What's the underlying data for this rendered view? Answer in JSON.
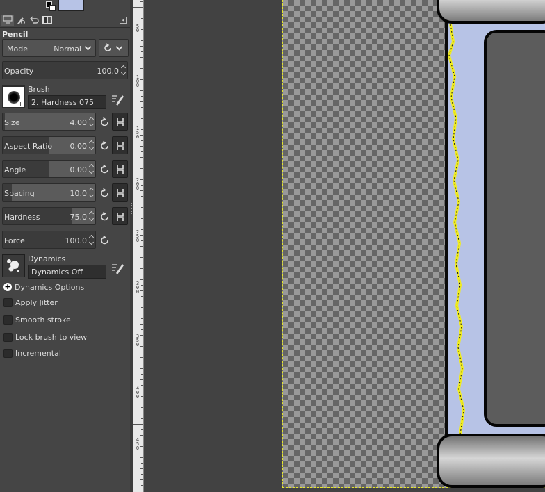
{
  "colors": {
    "foreground_swatch": "#b7c3e6",
    "panel_bg": "#454545",
    "selection_marching_ants": "#e6e62a",
    "drawing_fill": "#b7c3e6"
  },
  "tabs": [
    {
      "icon": "tool-options-icon"
    },
    {
      "icon": "device-status-icon"
    },
    {
      "icon": "undo-history-icon"
    },
    {
      "icon": "images-icon"
    }
  ],
  "tool": {
    "title": "Pencil",
    "mode_label": "Mode",
    "mode_value": "Normal",
    "opacity": {
      "label": "Opacity",
      "value": "100.0",
      "fraction": 1.0
    },
    "brush": {
      "title": "Brush",
      "name": "2. Hardness 075"
    },
    "sliders": [
      {
        "key": "size",
        "label": "Size",
        "value": "4.00",
        "fraction": 0.005
      },
      {
        "key": "aspect",
        "label": "Aspect Ratio",
        "value": "0.00",
        "fraction": 0.5
      },
      {
        "key": "angle",
        "label": "Angle",
        "value": "0.00",
        "fraction": 0.5
      },
      {
        "key": "spacing",
        "label": "Spacing",
        "value": "10.0",
        "fraction": 0.1
      },
      {
        "key": "hardness",
        "label": "Hardness",
        "value": "75.0",
        "fraction": 0.75
      }
    ],
    "force": {
      "label": "Force",
      "value": "100.0",
      "fraction": 1.0
    },
    "dynamics": {
      "title": "Dynamics",
      "name": "Dynamics Off"
    },
    "dynamics_options_label": "Dynamics Options",
    "options": [
      {
        "label": "Apply Jitter",
        "checked": false
      },
      {
        "label": "Smooth stroke",
        "checked": false
      },
      {
        "label": "Lock brush to view",
        "checked": false
      },
      {
        "label": "Incremental",
        "checked": false
      }
    ]
  },
  "ruler": {
    "labels": [
      "5\n0",
      "1\n0\n0",
      "1\n5\n0",
      "2\n0\n0",
      "2\n5\n0",
      "3\n0\n0",
      "3\n5\n0",
      "4\n0\n0",
      "4\n5\n0"
    ]
  }
}
